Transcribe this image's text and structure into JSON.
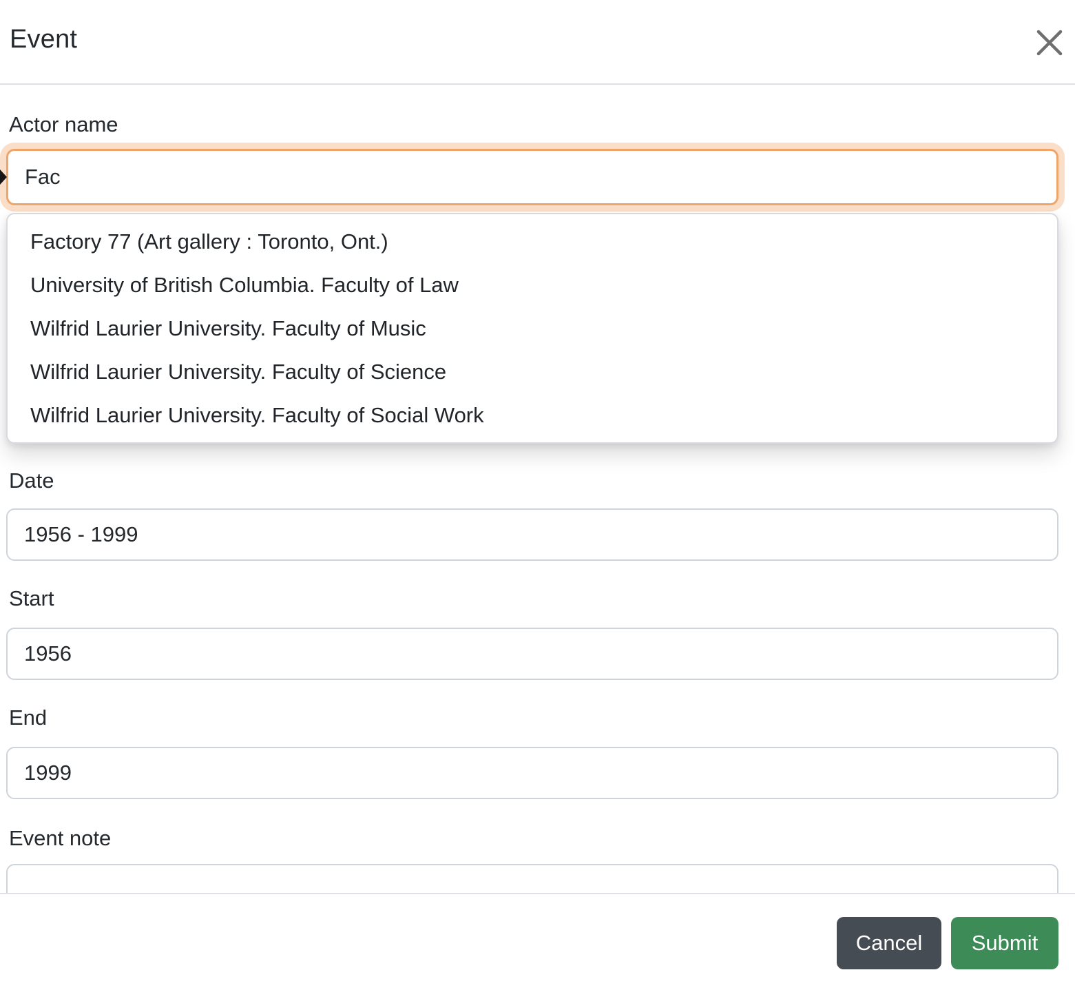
{
  "modal": {
    "title": "Event",
    "fields": {
      "actor_name": {
        "label": "Actor name",
        "value": "Fac",
        "placeholder": ""
      },
      "date": {
        "label": "Date",
        "value": "1956 - 1999",
        "placeholder": ""
      },
      "start": {
        "label": "Start",
        "value": "1956",
        "placeholder": ""
      },
      "end": {
        "label": "End",
        "value": "1999",
        "placeholder": ""
      },
      "event_note": {
        "label": "Event note",
        "value": "",
        "placeholder": ""
      }
    },
    "autocomplete": {
      "items": [
        "Factory 77 (Art gallery : Toronto, Ont.)",
        "University of British Columbia. Faculty of Law",
        "Wilfrid Laurier University. Faculty of Music",
        "Wilfrid Laurier University. Faculty of Science",
        "Wilfrid Laurier University. Faculty of Social Work"
      ]
    },
    "footer": {
      "cancel_label": "Cancel",
      "submit_label": "Submit"
    },
    "icons": {
      "close": "close-x"
    },
    "colors": {
      "submit_bg": "#3d8c58",
      "cancel_bg": "#454c53",
      "focus_border": "#efa468",
      "focus_glow": "rgba(244,177,122,0.42)",
      "input_border": "#ced4da",
      "divider": "#dee2e6",
      "text": "#24292e",
      "close_icon": "#6f6f6f"
    }
  }
}
